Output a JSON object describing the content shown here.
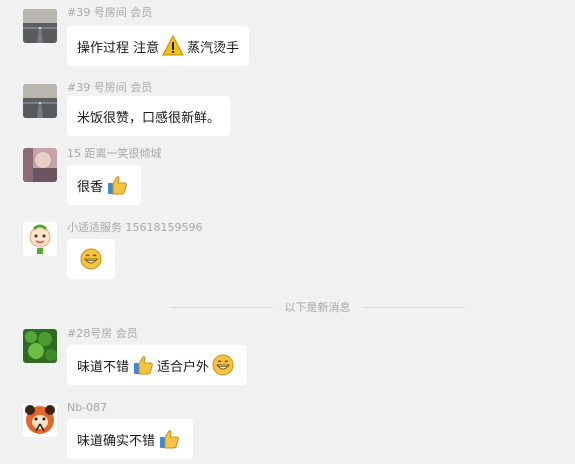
{
  "messages": [
    {
      "sender": "#39 号房间 会员",
      "parts": [
        "操作过程 注意",
        "蒸汽烫手"
      ]
    },
    {
      "sender": "#39 号房间 会员",
      "parts": [
        "米饭很赞，口感很新鲜。"
      ]
    },
    {
      "sender": "15 距离一笑很倾城",
      "parts": [
        "很香"
      ]
    },
    {
      "sender": "小适适服务 15618159596",
      "parts": []
    },
    {
      "sender": "#28号房 会员",
      "parts": [
        "味道不错",
        "适合户外"
      ]
    },
    {
      "sender": "Nb-087",
      "parts": [
        "味道确实不错"
      ]
    }
  ],
  "divider": {
    "label": "以下是新消息"
  },
  "icons": {
    "warning": "warning-icon",
    "thumbs_up": "thumbs-up-icon",
    "grin": "grin-emoji-icon"
  },
  "colors": {
    "background": "#f1f1f1",
    "bubble": "#ffffff",
    "meta_text": "#a8a8a8",
    "emoji_yellow": "#f6c443"
  }
}
